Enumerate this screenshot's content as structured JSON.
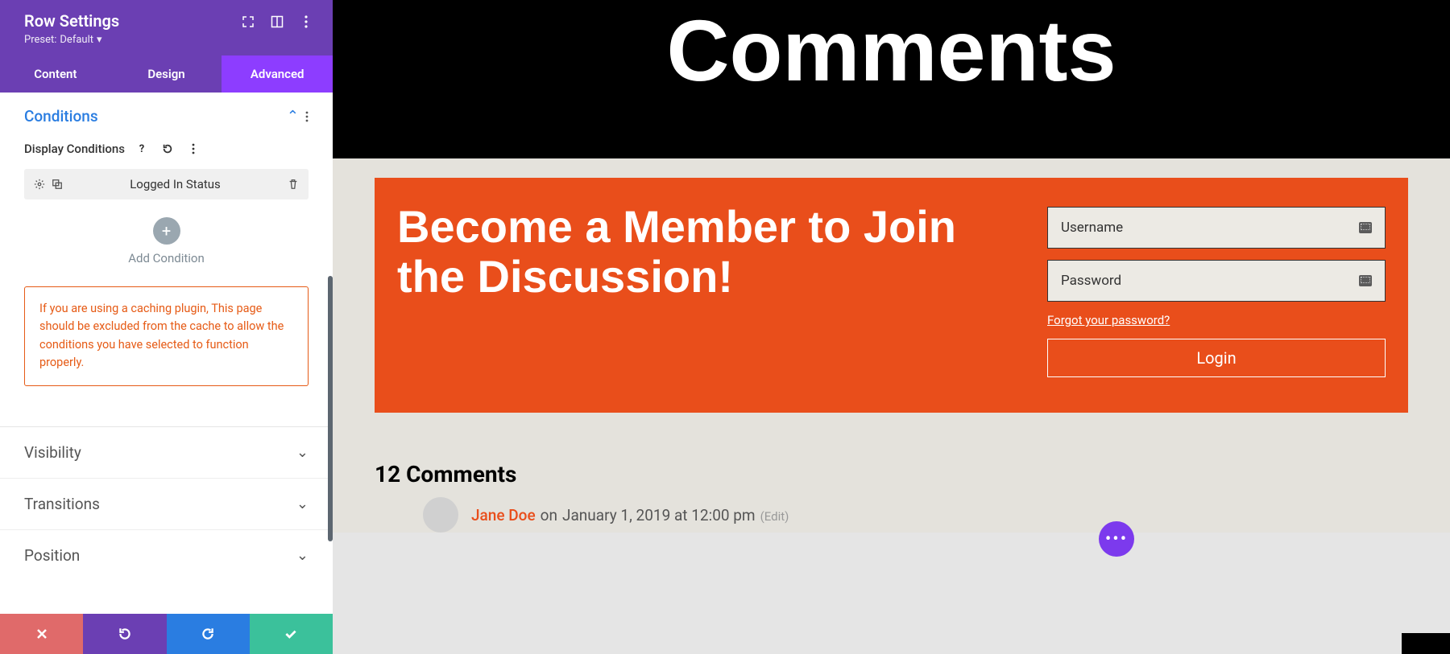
{
  "sidebar": {
    "title": "Row Settings",
    "preset_label": "Preset:",
    "preset_value": "Default",
    "tabs": {
      "content": "Content",
      "design": "Design",
      "advanced": "Advanced"
    },
    "sections": {
      "conditions": {
        "title": "Conditions",
        "label": "Display Conditions",
        "item": "Logged In Status",
        "add_label": "Add Condition",
        "warning": "If you are using a caching plugin, This page should be excluded from the cache to allow the conditions you have selected to function properly."
      },
      "visibility": "Visibility",
      "transitions": "Transitions",
      "position": "Position"
    }
  },
  "preview": {
    "banner": "Comments",
    "card": {
      "heading": "Become a Member to Join the Discussion!",
      "username_ph": "Username",
      "password_ph": "Password",
      "forgot": "Forgot your password?",
      "login": "Login"
    },
    "comments": {
      "heading": "12 Comments",
      "item": {
        "author": "Jane Doe",
        "on": "on",
        "date": "January 1, 2019 at 12:00 pm",
        "edit": "(Edit)"
      }
    }
  }
}
